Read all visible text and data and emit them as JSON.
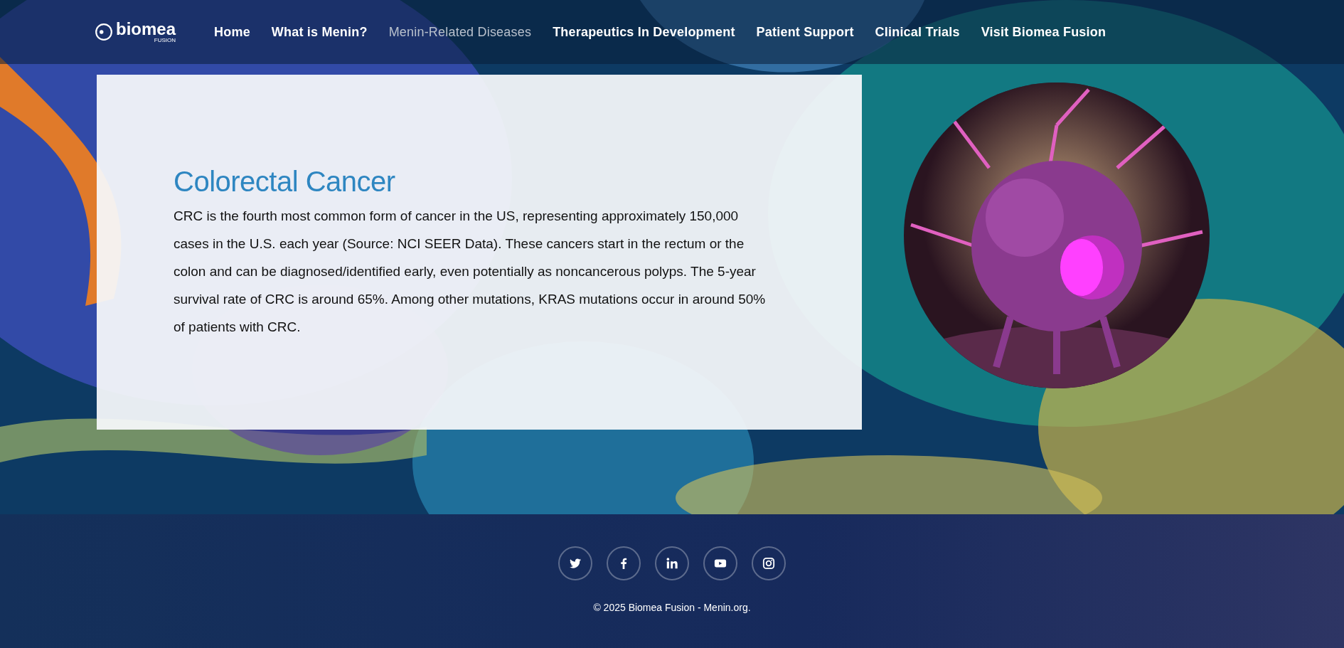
{
  "logo": {
    "name": "biomea",
    "tagline": "FUSION"
  },
  "nav": [
    {
      "label": "Home",
      "selected": false
    },
    {
      "label": "What is Menin?",
      "selected": false
    },
    {
      "label": "Menin-Related Diseases",
      "selected": true
    },
    {
      "label": "Therapeutics In Development",
      "selected": false
    },
    {
      "label": "Patient Support",
      "selected": false
    },
    {
      "label": "Clinical Trials",
      "selected": false
    },
    {
      "label": "Visit Biomea Fusion",
      "selected": false
    }
  ],
  "article": {
    "title": "Colorectal Cancer",
    "body": "CRC is the fourth most common form of cancer in the US, representing approximately 150,000 cases in the U.S. each year (Source: NCI SEER Data). These cancers start in the rectum or the colon and can be diagnosed/identified early, even potentially as noncancerous polyps. The 5-year survival rate of CRC is around 65%. Among other mutations, KRAS mutations occur in around 50% of patients with CRC."
  },
  "footer": {
    "social": [
      {
        "kind": "twitter"
      },
      {
        "kind": "facebook"
      },
      {
        "kind": "linkedin"
      },
      {
        "kind": "youtube"
      },
      {
        "kind": "instagram"
      }
    ],
    "copyright": "© 2025 Biomea Fusion - Menin.org."
  }
}
